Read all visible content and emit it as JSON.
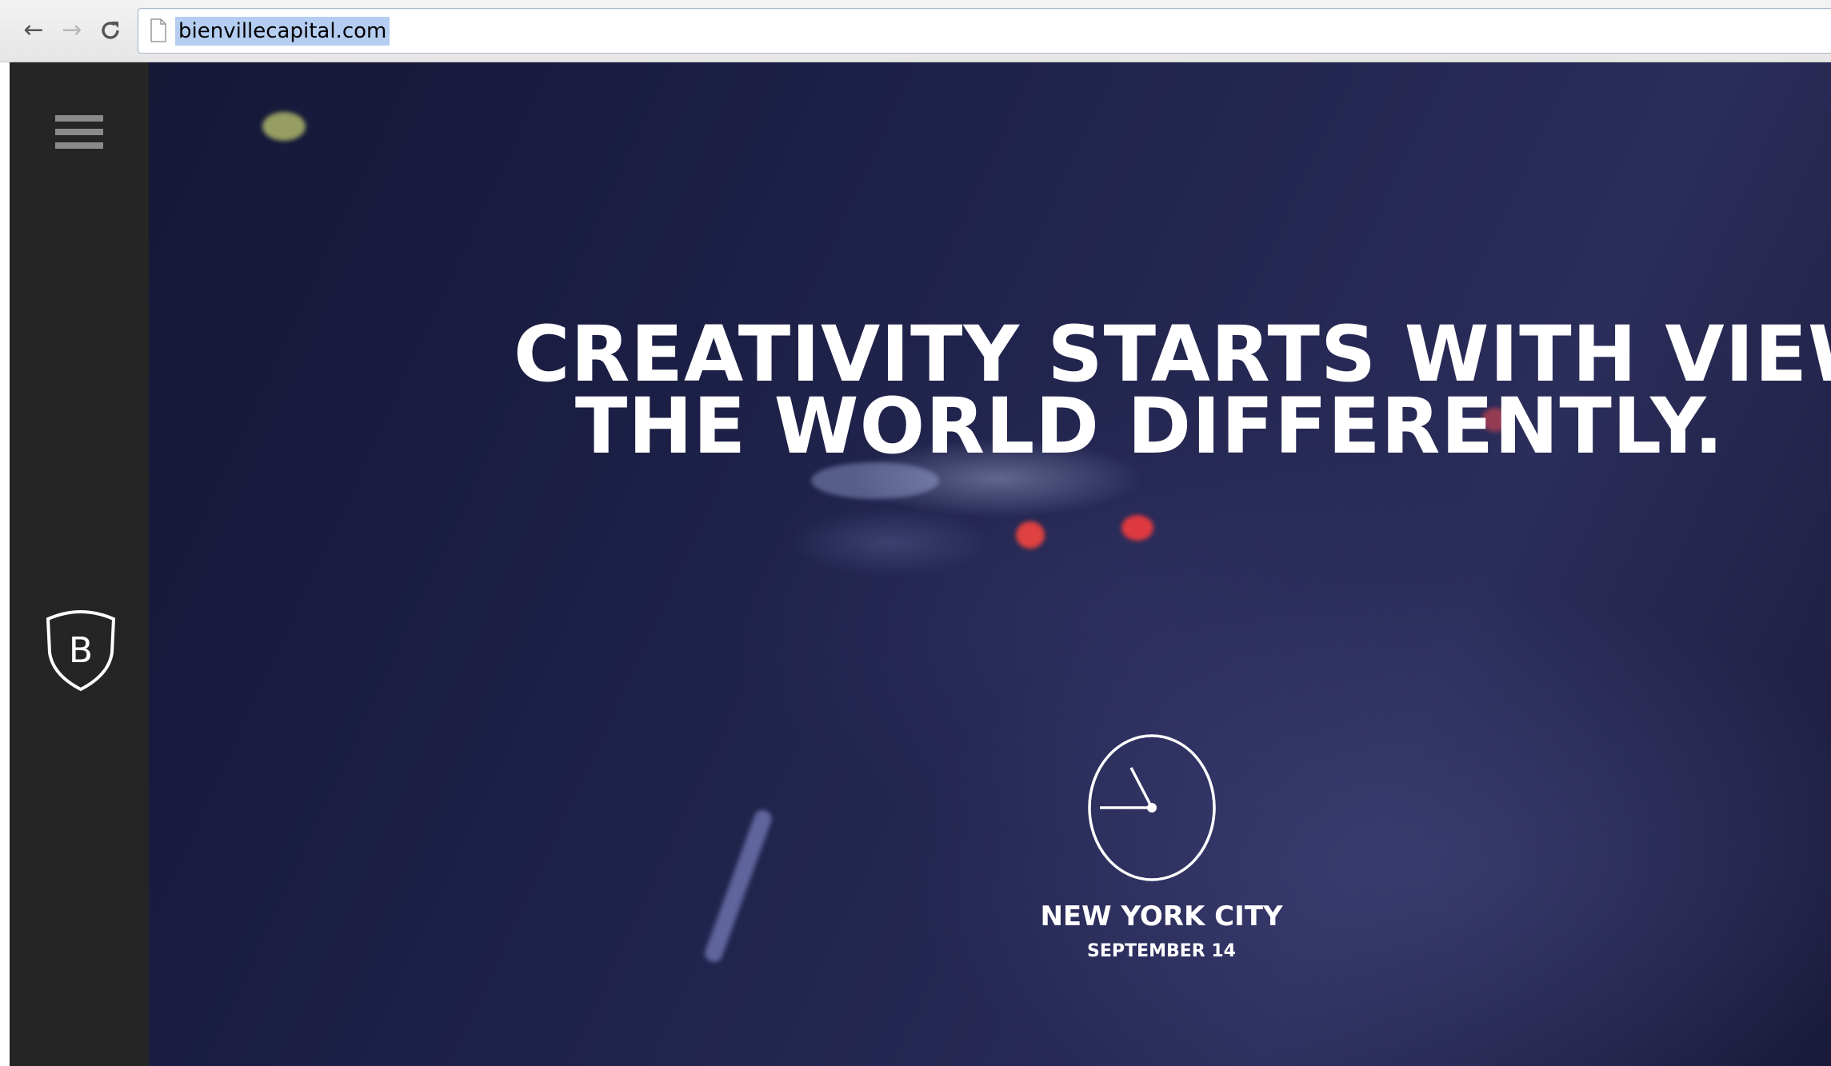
{
  "browser": {
    "url": "bienvillecapital.com",
    "back_icon": "back-arrow-icon",
    "forward_icon": "forward-arrow-icon",
    "reload_icon": "reload-icon"
  },
  "sidebar": {
    "menu_icon": "hamburger-menu-icon",
    "logo": {
      "letter": "B"
    }
  },
  "hero": {
    "headline_line1": "CREATIVITY STARTS WITH VIEWING",
    "headline_line2": "THE WORLD DIFFERENTLY.",
    "city": "NEW YORK CITY",
    "date": "SEPTEMBER 14"
  },
  "colors": {
    "sidebar_bg": "#252525",
    "hero_text": "#ffffff",
    "url_highlight": "#b4cdf1"
  }
}
